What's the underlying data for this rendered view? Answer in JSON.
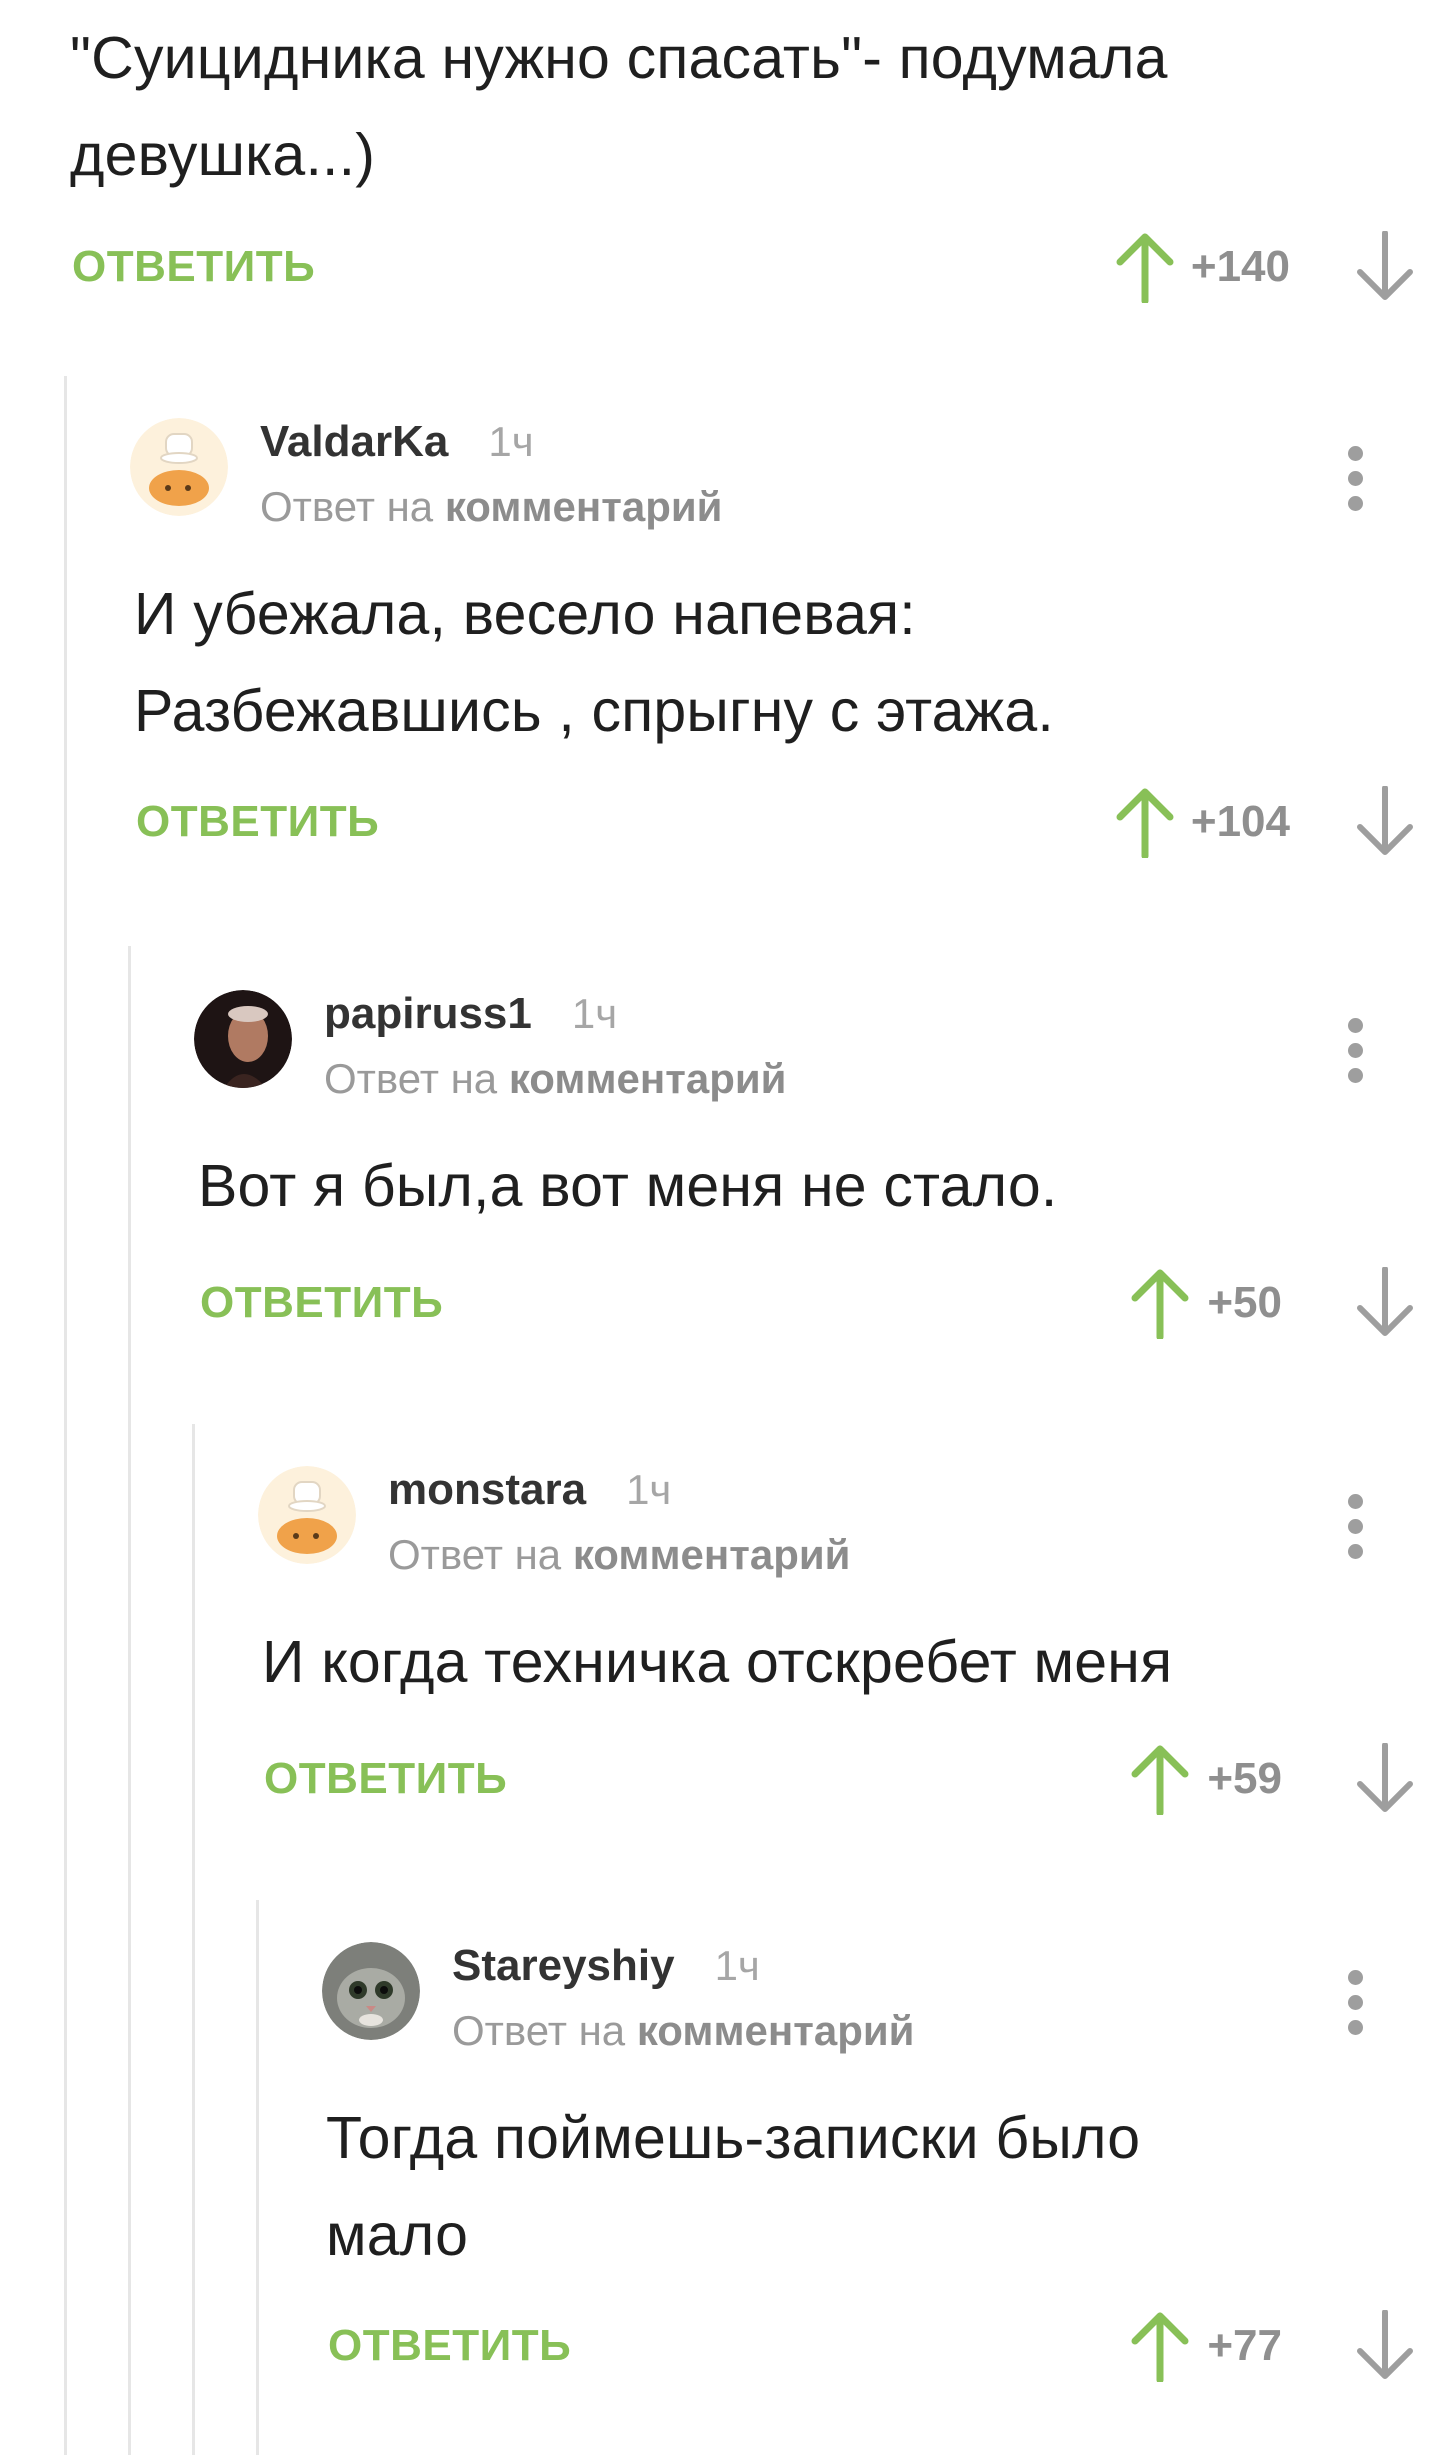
{
  "colors": {
    "accent_green": "#88c057",
    "score_gray": "#8f8f8f",
    "thread_line": "#e6e6e6",
    "text": "#1f1f1f"
  },
  "top_comment": {
    "body_lines": [
      "\"Суицидника нужно спасать\"- подумала",
      "девушка...)"
    ],
    "reply_label": "ОТВЕТИТЬ",
    "score": "+140",
    "upvote_icon": "arrow-up-icon",
    "downvote_icon": "arrow-down-icon"
  },
  "comments": [
    {
      "username": "ValdarKa",
      "time": "1ч",
      "reply_prefix": "Ответ на",
      "reply_target": "комментарий",
      "avatar_icon": "cheburashka-chef-avatar",
      "body_lines": [
        "И убежала, весело напевая:",
        "Разбежавшись , спрыгну с этажа."
      ],
      "reply_label": "ОТВЕТИТЬ",
      "score": "+104",
      "menu_icon": "more-vertical-icon"
    },
    {
      "username": "papiruss1",
      "time": "1ч",
      "reply_prefix": "Ответ на",
      "reply_target": "комментарий",
      "avatar_icon": "man-photo-avatar",
      "body_lines": [
        "Вот я был,а вот меня не стало."
      ],
      "reply_label": "ОТВЕТИТЬ",
      "score": "+50",
      "menu_icon": "more-vertical-icon"
    },
    {
      "username": "monstara",
      "time": "1ч",
      "reply_prefix": "Ответ на",
      "reply_target": "комментарий",
      "avatar_icon": "cheburashka-chef-avatar",
      "body_lines": [
        "И когда техничка отскребет меня"
      ],
      "reply_label": "ОТВЕТИТЬ",
      "score": "+59",
      "menu_icon": "more-vertical-icon"
    },
    {
      "username": "Stareyshiy",
      "time": "1ч",
      "reply_prefix": "Ответ на",
      "reply_target": "комментарий",
      "avatar_icon": "cat-photo-avatar",
      "body_lines": [
        "Тогда поймешь-записки было",
        "мало"
      ],
      "reply_label": "ОТВЕТИТЬ",
      "score": "+77",
      "menu_icon": "more-vertical-icon"
    }
  ]
}
